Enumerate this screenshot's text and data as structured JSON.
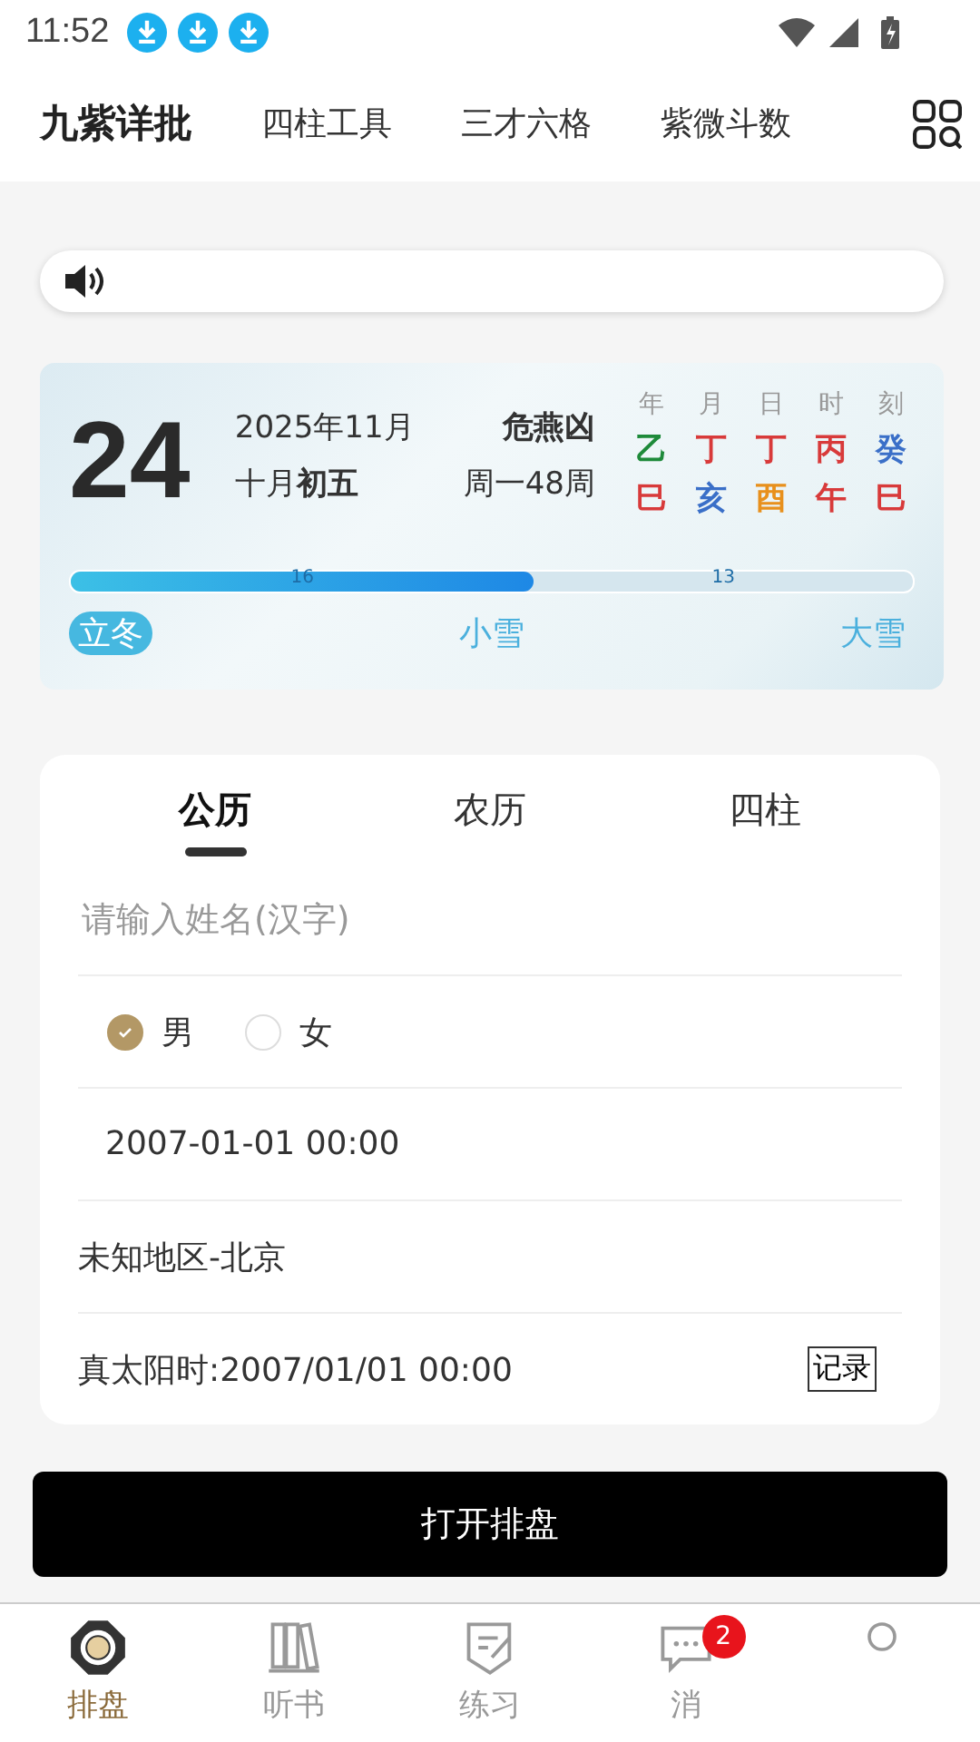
{
  "status_bar": {
    "time": "11:52"
  },
  "header": {
    "title": "九紫详批",
    "links": [
      "四柱工具",
      "三才六格",
      "紫微斗数"
    ]
  },
  "calendar": {
    "day": "24",
    "month": "2025年11月",
    "lunar_month": "十月",
    "lunar_day": "初五",
    "omen": "危燕凶",
    "week": "周一48周",
    "pillar_heads": [
      "年",
      "月",
      "日",
      "时",
      "刻"
    ],
    "stems": [
      {
        "text": "乙",
        "color": "#1e8a3a"
      },
      {
        "text": "丁",
        "color": "#d83a3a"
      },
      {
        "text": "丁",
        "color": "#d83a3a"
      },
      {
        "text": "丙",
        "color": "#d83a3a"
      },
      {
        "text": "癸",
        "color": "#3a6fc8"
      }
    ],
    "branches": [
      {
        "text": "巳",
        "color": "#d83a3a"
      },
      {
        "text": "亥",
        "color": "#3a6fc8"
      },
      {
        "text": "酉",
        "color": "#e8901c"
      },
      {
        "text": "午",
        "color": "#d83a3a"
      },
      {
        "text": "巳",
        "color": "#d83a3a"
      }
    ],
    "progress": {
      "level": 0.55,
      "passed": "16",
      "remaining": "13"
    },
    "terms": [
      {
        "label": "立冬",
        "selected": true
      },
      {
        "label": "小雪",
        "selected": false
      },
      {
        "label": "大雪",
        "selected": false
      }
    ]
  },
  "form": {
    "tabs": [
      {
        "label": "公历",
        "selected": true
      },
      {
        "label": "农历",
        "selected": false
      },
      {
        "label": "四柱",
        "selected": false
      }
    ],
    "name_placeholder": "请输入姓名(汉字)",
    "genders": [
      {
        "label": "男",
        "selected": true
      },
      {
        "label": "女",
        "selected": false
      }
    ],
    "birth_time": "2007-01-01 00:00",
    "location": "未知地区-北京",
    "solar_time_label": "真太阳时:",
    "solar_time": "2007/01/01 00:00",
    "record_button": "记录"
  },
  "submit_button": "打开排盘",
  "bottom_nav": [
    {
      "label": "排盘",
      "selected": true
    },
    {
      "label": "听书",
      "selected": false
    },
    {
      "label": "练习",
      "selected": false
    },
    {
      "label": "消",
      "selected": false,
      "badge": "2"
    },
    {
      "selected": false
    }
  ]
}
